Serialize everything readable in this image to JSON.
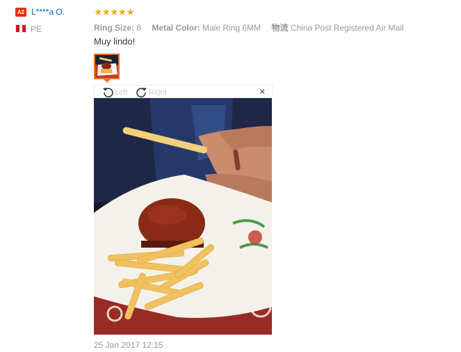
{
  "reviewer": {
    "level_badge": "A2",
    "name": "L****a O.",
    "country": "PE"
  },
  "rating": {
    "stars": 5,
    "glyphs": "★★★★★"
  },
  "attributes": [
    {
      "label": "Ring Size:",
      "value": "8"
    },
    {
      "label": "Metal Color:",
      "value": "Male Ring 6MM"
    },
    {
      "label": "物流",
      "value": "China Post Registered Air Mail"
    }
  ],
  "review": {
    "text": "Muy lindo!"
  },
  "viewer": {
    "rotate_left_label": "Left",
    "rotate_right_label": "Right",
    "close_label": "×"
  },
  "date": "25 Jan 2017 12:15",
  "colors": {
    "accent": "#f57224",
    "star": "#f5a623",
    "link": "#0066c0",
    "badge": "#e62e04"
  },
  "icons": [
    "rotate-left-icon",
    "rotate-right-icon",
    "close-icon",
    "flag-pe-icon"
  ]
}
